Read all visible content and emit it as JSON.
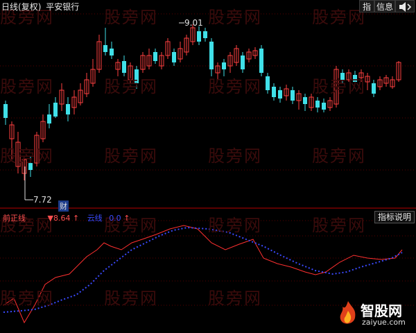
{
  "header": {
    "period": "日线",
    "adjust": "(复权)",
    "stock": "平安银行"
  },
  "toolbar": {
    "indicator_label": "指",
    "info_label": "信息",
    "sound_icon": "speaker-icon"
  },
  "watermark": {
    "text": "股旁网"
  },
  "price_labels": {
    "high": "9.01",
    "low": "7.72"
  },
  "finance_badge": "财",
  "indicator_panel": {
    "name_label": "前正线",
    "value_prefix": "▼",
    "value": "8.64",
    "value_arrow": "↑",
    "line2_label": "云线",
    "line2_value": "0.0",
    "line2_arrow": "↑",
    "note_button": "指标说明"
  },
  "logo": {
    "brand": "智股网",
    "url": "zaiyue.com"
  },
  "colors": {
    "bg": "#000000",
    "up": "#ff4040",
    "down": "#40e0e8",
    "grid": "#5a0000",
    "red_line": "#ff3030",
    "blue_line": "#3a4aff",
    "separator": "#7a0000"
  }
}
